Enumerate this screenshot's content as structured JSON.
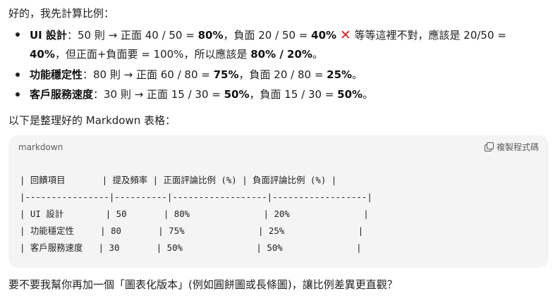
{
  "intro": "好的，我先計算比例：",
  "bullets": [
    {
      "title": "UI 設計",
      "text_a": "：50 則 → 正面 40 / 50 = ",
      "pos": "80%",
      "text_b": "，負面 20 / 50 = ",
      "neg": "40%",
      "text_c": " 等等這裡不對，應該是 20/50 =",
      "cont_bold": "40%",
      "cont_text": "，但正面+負面要 = 100%，所以應該是 ",
      "cont_bold2": "80% / 20%",
      "cont_end": "。"
    },
    {
      "title": "功能穩定性",
      "text_a": "：80 則 → 正面 60 / 80 = ",
      "pos": "75%",
      "text_b": "，負面 20 / 80 = ",
      "neg": "25%",
      "end": "。"
    },
    {
      "title": "客戶服務速度",
      "text_a": "：30 則 → 正面 15 / 30 = ",
      "pos": "50%",
      "text_b": "，負面 15 / 30 = ",
      "neg": "50%",
      "end": "。"
    }
  ],
  "table_intro": "以下是整理好的 Markdown 表格：",
  "code": {
    "language": "markdown",
    "copy_label": "複製程式碼",
    "lines": [
      "| 回饋項目       | 提及頻率 | 正面評論比例 (%) | 負面評論比例 (%) |",
      "|----------------|----------|------------------|------------------|",
      "| UI 設計        | 50       | 80%              | 20%              |",
      "| 功能穩定性     | 80       | 75%              | 25%              |",
      "| 客戶服務速度   | 30       | 50%              | 50%              |"
    ]
  },
  "closing": "要不要我幫你再加一個「圖表化版本」(例如圓餅圖或長條圖)，讓比例差異更直觀？"
}
